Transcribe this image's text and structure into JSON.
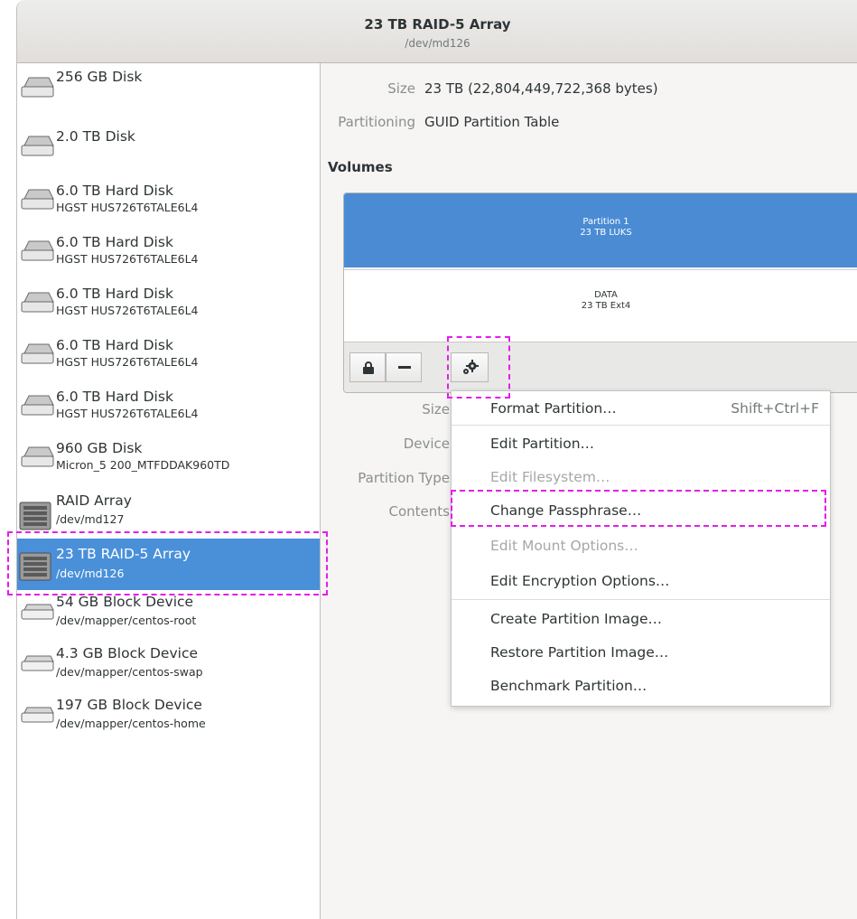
{
  "window": {
    "title": "23 TB RAID-5 Array",
    "subtitle": "/dev/md126"
  },
  "sidebar": {
    "items": [
      {
        "name": "256 GB Disk",
        "sub": "",
        "icon": "disk-icon"
      },
      {
        "name": "2.0 TB Disk",
        "sub": "",
        "icon": "disk-icon"
      },
      {
        "name": "6.0 TB Hard Disk",
        "sub": "HGST HUS726T6TALE6L4",
        "icon": "hard-disk-icon"
      },
      {
        "name": "6.0 TB Hard Disk",
        "sub": "HGST HUS726T6TALE6L4",
        "icon": "hard-disk-icon"
      },
      {
        "name": "6.0 TB Hard Disk",
        "sub": "HGST HUS726T6TALE6L4",
        "icon": "hard-disk-icon"
      },
      {
        "name": "6.0 TB Hard Disk",
        "sub": "HGST HUS726T6TALE6L4",
        "icon": "hard-disk-icon"
      },
      {
        "name": "6.0 TB Hard Disk",
        "sub": "HGST HUS726T6TALE6L4",
        "icon": "hard-disk-icon"
      },
      {
        "name": "960 GB Disk",
        "sub": "Micron_5 200_MTFDDAK960TD",
        "icon": "disk-icon"
      },
      {
        "name": "RAID Array",
        "sub": "/dev/md127",
        "icon": "raid-array-icon"
      },
      {
        "name": "23 TB RAID-5 Array",
        "sub": "/dev/md126",
        "icon": "raid-array-icon",
        "selected": true
      },
      {
        "name": "54 GB Block Device",
        "sub": "/dev/mapper/centos-root",
        "icon": "block-device-icon"
      },
      {
        "name": "4.3 GB Block Device",
        "sub": "/dev/mapper/centos-swap",
        "icon": "block-device-icon"
      },
      {
        "name": "197 GB Block Device",
        "sub": "/dev/mapper/centos-home",
        "icon": "block-device-icon"
      }
    ]
  },
  "details": {
    "size_label": "Size",
    "size_value": "23 TB (22,804,449,722,368 bytes)",
    "partitioning_label": "Partitioning",
    "partitioning_value": "GUID Partition Table",
    "volumes_title": "Volumes"
  },
  "volumes": {
    "partition1": {
      "name": "Partition 1",
      "desc": "23 TB LUKS"
    },
    "partition2": {
      "name": "DATA",
      "desc": "23 TB Ext4"
    },
    "toolbar": {
      "lock_icon": "lock-icon",
      "minus_icon": "minus-icon",
      "gears_icon": "gears-icon"
    }
  },
  "lower_labels": {
    "size": "Size",
    "device": "Device",
    "partition_type": "Partition Type",
    "contents": "Contents"
  },
  "menu": {
    "items": [
      {
        "label": "Format Partition…",
        "accel": "Shift+Ctrl+F",
        "enabled": true
      },
      {
        "label": "Edit Partition…",
        "accel": "",
        "enabled": true
      },
      {
        "label": "Edit Filesystem…",
        "accel": "",
        "enabled": false
      },
      {
        "label": "Change Passphrase…",
        "accel": "",
        "enabled": true
      },
      {
        "label": "Edit Mount Options…",
        "accel": "",
        "enabled": false
      },
      {
        "label": "Edit Encryption Options…",
        "accel": "",
        "enabled": true
      },
      {
        "label": "Create Partition Image…",
        "accel": "",
        "enabled": true
      },
      {
        "label": "Restore Partition Image…",
        "accel": "",
        "enabled": true
      },
      {
        "label": "Benchmark Partition…",
        "accel": "",
        "enabled": true
      }
    ]
  },
  "colors": {
    "selection": "#4a90d9",
    "partition_selected": "#4a8bd4",
    "highlight_dashed": "#e31ee8"
  }
}
